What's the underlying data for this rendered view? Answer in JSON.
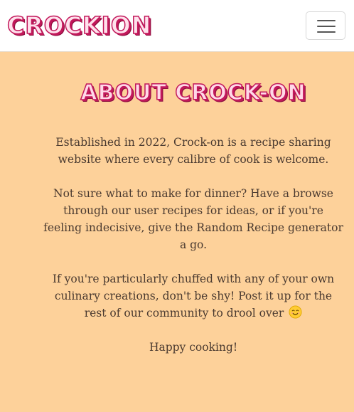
{
  "navbar": {
    "brand": "CROCKION",
    "toggler_icon": "hamburger-menu-icon"
  },
  "main": {
    "title": "ABOUT CROCK-ON",
    "paragraphs": [
      "Established in 2022, Crock-on is a recipe sharing website where every calibre of cook is welcome.",
      "Not sure what to make for dinner? Have a browse through our user recipes for ideas, or if you're feeling indecisive, give the Random Recipe generator a go.",
      "If you're particularly chuffed with any of your own culinary creations, don't be shy! Post it up for the rest of our community to drool over",
      "Happy cooking!"
    ],
    "emoji_icon": "smiling-face-emoji-icon"
  },
  "colors": {
    "background": "#fdd19a",
    "navbar": "#ffffff",
    "brand_accent": "#c2185b",
    "text": "#4a3a30"
  }
}
